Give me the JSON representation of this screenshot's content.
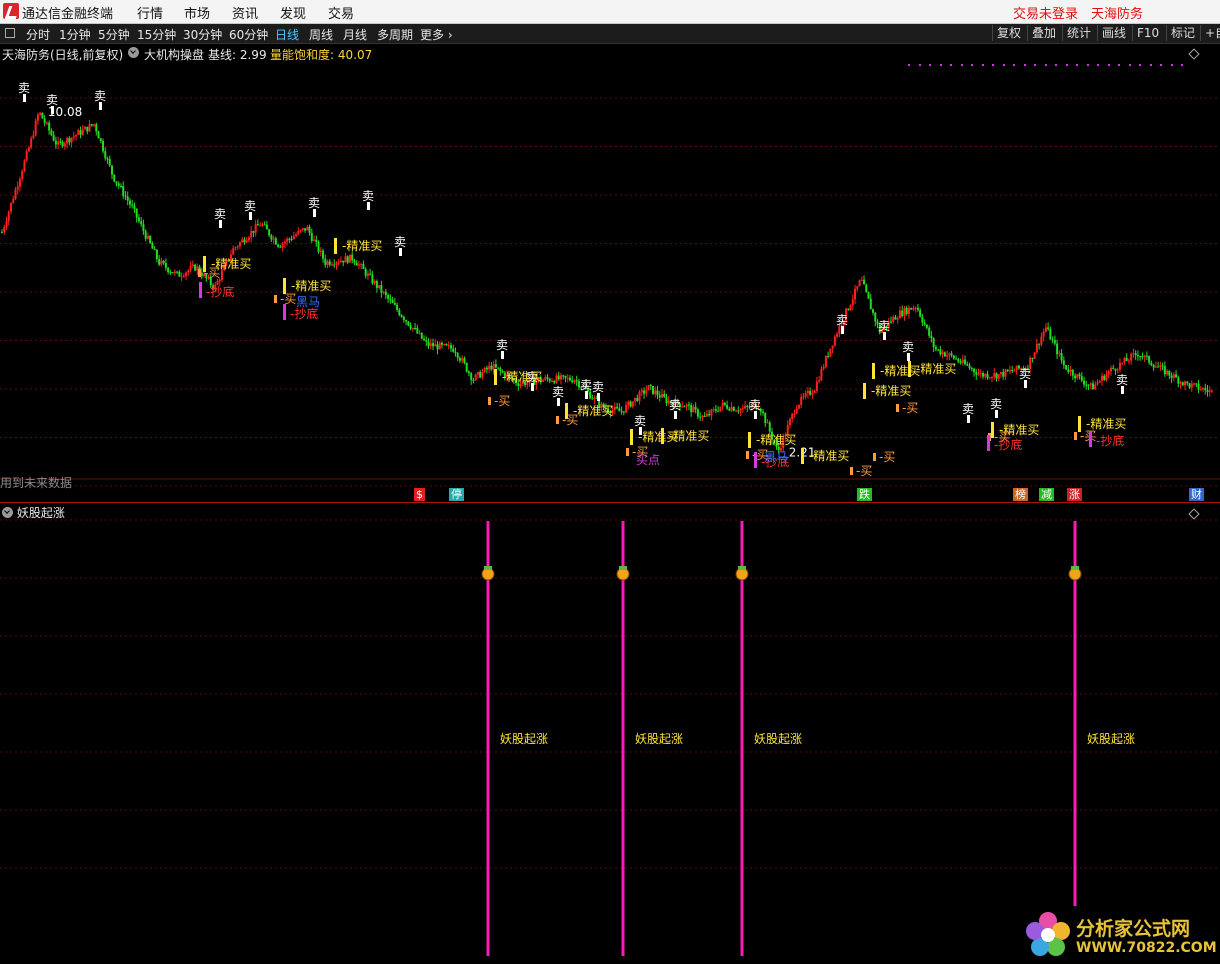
{
  "app": {
    "title": "通达信金融终端"
  },
  "menu": [
    "行情",
    "市场",
    "资讯",
    "发现",
    "交易"
  ],
  "menu_right": {
    "login": "交易未登录",
    "stock": "天海防务"
  },
  "periods": [
    "分时",
    "1分钟",
    "5分钟",
    "15分钟",
    "30分钟",
    "60分钟",
    "日线",
    "周线",
    "月线",
    "多周期",
    "更多 ›"
  ],
  "active_period": "日线",
  "tools": [
    "复权",
    "叠加",
    "统计",
    "画线",
    "F10",
    "标记",
    "+自"
  ],
  "info": {
    "stock_title": "天海防务(日线,前复权)",
    "indicator": "大机构操盘",
    "baseline_label": "基线: 2.99",
    "saturation_label": "量能饱和度: 40.07"
  },
  "price_labels": {
    "high": "10.08",
    "low": "2.21"
  },
  "future_note": "用到未来数据",
  "event_badges": [
    {
      "text": "$",
      "color": "#d22"
    },
    {
      "text": "停",
      "color": "#2aa"
    },
    {
      "text": "跌",
      "color": "#2b2"
    },
    {
      "text": "榜",
      "color": "#c62"
    },
    {
      "text": "减",
      "color": "#2b2"
    },
    {
      "text": "涨",
      "color": "#c22"
    },
    {
      "text": "财",
      "color": "#36c"
    }
  ],
  "signals": {
    "sell": "卖",
    "buy": "买",
    "precise_buy": "精准买",
    "bottom": "抄底",
    "dark_horse": "黑马",
    "buy_point": "买点"
  },
  "sub_panel": {
    "title": "妖股起涨",
    "signal_label": "妖股起涨",
    "signal_count": 4
  },
  "watermark": {
    "line1": "分析家公式网",
    "line2": "WWW.70822.COM"
  },
  "colors": {
    "up": "#ff2020",
    "down": "#22dd22",
    "sell_label": "#ffffff",
    "precise_buy": "#ffe23a",
    "buy": "#ff9a40",
    "bottom": "#ff3030",
    "dark_horse": "#3a6cff",
    "signal_line": "#ff1ab8",
    "grid": "#5a0c0c"
  },
  "chart_data": {
    "type": "candlestick",
    "price_range": [
      1.8,
      11.0
    ],
    "high": 10.08,
    "low": 2.21,
    "trend": [
      [
        0,
        7.3
      ],
      [
        3,
        9.3
      ],
      [
        4,
        10.08
      ],
      [
        6,
        9.3
      ],
      [
        8,
        9.55
      ],
      [
        10,
        9.8
      ],
      [
        12,
        8.6
      ],
      [
        14,
        7.9
      ],
      [
        17,
        6.6
      ],
      [
        19,
        6.3
      ],
      [
        21,
        6.5
      ],
      [
        23,
        6.0
      ],
      [
        25,
        6.9
      ],
      [
        28,
        7.5
      ],
      [
        30,
        7.0
      ],
      [
        33,
        7.4
      ],
      [
        35,
        6.6
      ],
      [
        38,
        6.7
      ],
      [
        42,
        5.7
      ],
      [
        46,
        4.7
      ],
      [
        49,
        4.6
      ],
      [
        51,
        3.9
      ],
      [
        53,
        4.2
      ],
      [
        56,
        3.8
      ],
      [
        59,
        3.9
      ],
      [
        62,
        3.9
      ],
      [
        65,
        3.25
      ],
      [
        67,
        3.15
      ],
      [
        70,
        3.7
      ],
      [
        72,
        3.4
      ],
      [
        74,
        3.3
      ],
      [
        76,
        3.0
      ],
      [
        78,
        3.3
      ],
      [
        80,
        3.2
      ],
      [
        82,
        3.3
      ],
      [
        84,
        2.21
      ],
      [
        86,
        3.3
      ],
      [
        88,
        3.7
      ],
      [
        90,
        4.8
      ],
      [
        93,
        6.2
      ],
      [
        95,
        5.0
      ],
      [
        97,
        5.4
      ],
      [
        99,
        5.6
      ],
      [
        101,
        4.6
      ],
      [
        103,
        4.4
      ],
      [
        106,
        4.0
      ],
      [
        108,
        4.0
      ],
      [
        111,
        4.2
      ],
      [
        113,
        5.1
      ],
      [
        115,
        4.2
      ],
      [
        118,
        3.7
      ],
      [
        120,
        4.1
      ],
      [
        123,
        4.5
      ],
      [
        125,
        4.2
      ],
      [
        128,
        3.8
      ],
      [
        131,
        3.6
      ]
    ]
  }
}
